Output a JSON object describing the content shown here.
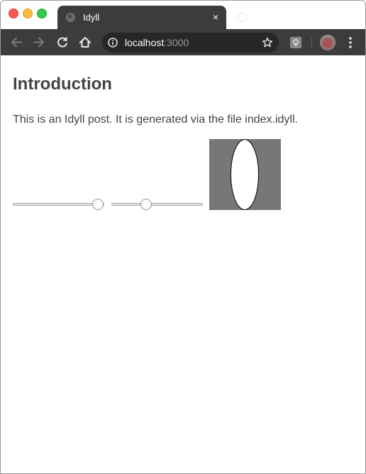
{
  "window": {
    "controls": [
      "close",
      "minimize",
      "zoom"
    ],
    "colors": {
      "close": "#fc5753",
      "minimize": "#fdbc40",
      "zoom": "#36c84b"
    }
  },
  "tab": {
    "title": "Idyll",
    "favicon": "globe-icon",
    "close_icon": "×",
    "active": true
  },
  "toolbar": {
    "back_icon": "arrow-left-icon",
    "forward_icon": "arrow-right-icon",
    "reload_icon": "reload-icon",
    "home_icon": "home-icon",
    "address": {
      "info_icon": "info-icon",
      "host": "localhost",
      "port": ":3000",
      "bookmark_icon": "star-icon"
    },
    "extension_icon": "extension-icon",
    "menu_icon": "more-vertical-icon"
  },
  "page": {
    "heading": "Introduction",
    "paragraph": "This is an Idyll post. It is generated via the file index.idyll.",
    "sliders": [
      {
        "name": "slider-1",
        "value_fraction": 1.0
      },
      {
        "name": "slider-2",
        "value_fraction": 0.4
      }
    ],
    "ellipse": {
      "background_color": "#777777",
      "fill_color": "#ffffff",
      "stroke_color": "#000000"
    }
  },
  "theme": {
    "chrome_dark": "#3c3c3c",
    "omnibox_bg": "#272727",
    "text_color": "#444444"
  }
}
